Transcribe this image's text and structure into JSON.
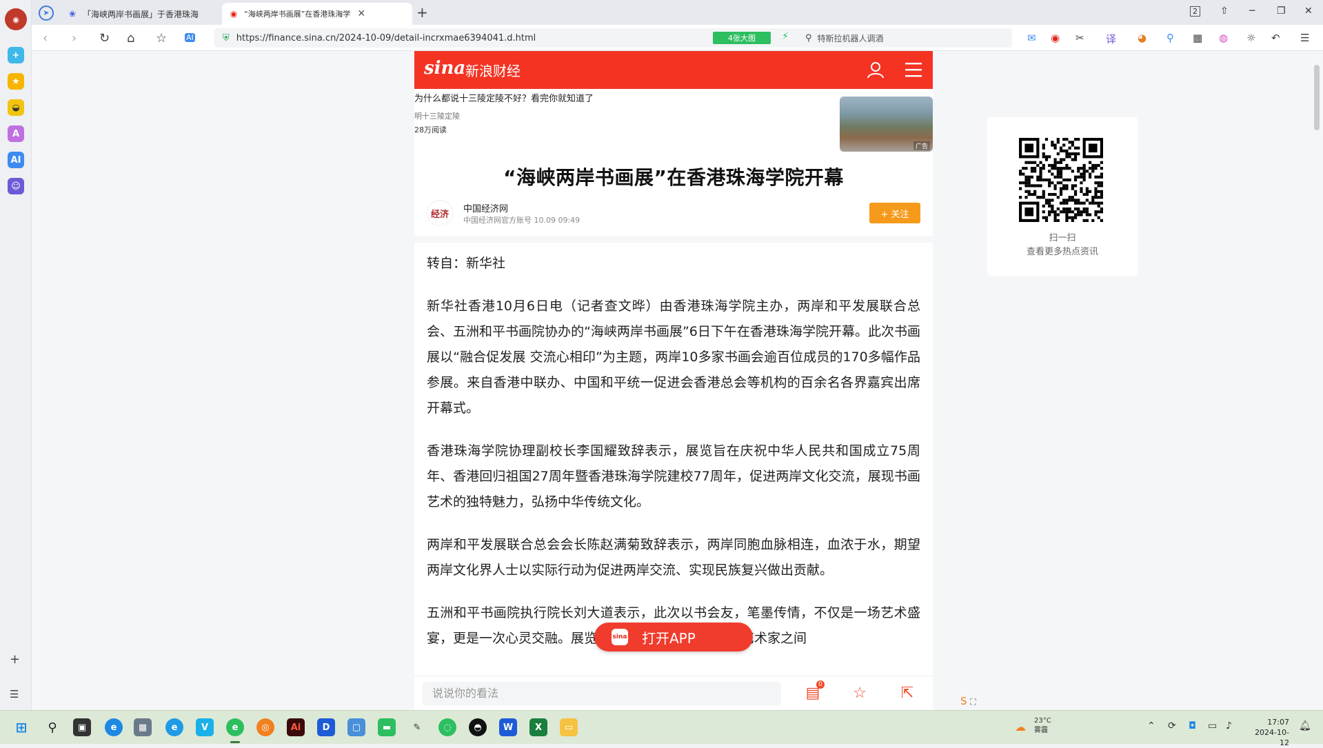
{
  "tabs": [
    {
      "title": "「海峡两岸书画展」于香港珠海",
      "active": false
    },
    {
      "title": "“海峡两岸书画展”在香港珠海学",
      "active": true
    }
  ],
  "window_controls": {
    "badge": "2"
  },
  "address_bar": {
    "url": "https://finance.sina.cn/2024-10-09/detail-incrxmae6394041.d.html",
    "ext_badge": "4张大图"
  },
  "search_box": {
    "placeholder": "特斯拉机器人调酒"
  },
  "site": {
    "channel": "新浪财经",
    "logo": "sina"
  },
  "ad": {
    "title": "为什么都说十三陵定陵不好？看完你就知道了",
    "source": "明十三陵定陵",
    "reads": "28万阅读",
    "tag": "广告"
  },
  "article": {
    "headline": "“海峡两岸书画展”在香港珠海学院开幕",
    "author": "中国经济网",
    "author_meta": "中国经济网官方账号  10.09  09:49",
    "follow_label": "+ 关注",
    "paragraphs": [
      "转自：新华社",
      "新华社香港10月6日电（记者查文晔）由香港珠海学院主办，两岸和平发展联合总会、五洲和平书画院协办的“海峡两岸书画展”6日下午在香港珠海学院开幕。此次书画展以“融合促发展 交流心相印”为主题，两岸10多家书画会逾百位成员的170多幅作品参展。来自香港中联办、中国和平统一促进会香港总会等机构的百余名各界嘉宾出席开幕式。",
      "香港珠海学院协理副校长李国耀致辞表示，展览旨在庆祝中华人民共和国成立75周年、香港回归祖国27周年暨香港珠海学院建校77周年，促进两岸文化交流，展现书画艺术的独特魅力，弘扬中华传统文化。",
      "两岸和平发展联合总会会长陈赵满菊致辞表示，两岸同胞血脉相连，血浓于水，期望两岸文化界人士以实际行动为促进两岸交流、实现民族复兴做出贡献。",
      "五洲和平书画院执行院长刘大道表示，此次以书会友，笔墨传情，不仅是一场艺术盛宴，更是一次心灵交融。展览将进一步加深两岸及港澳艺术家之间"
    ]
  },
  "open_app_label": "打开APP",
  "comment": {
    "placeholder": "说说你的看法",
    "badge": "0"
  },
  "qr": {
    "line1": "扫一扫",
    "line2": "查看更多热点资讯"
  },
  "taskbar": {
    "weather_temp": "23°C",
    "weather_desc": "雾霾",
    "time": "17:07",
    "date": "2024-10-12"
  }
}
